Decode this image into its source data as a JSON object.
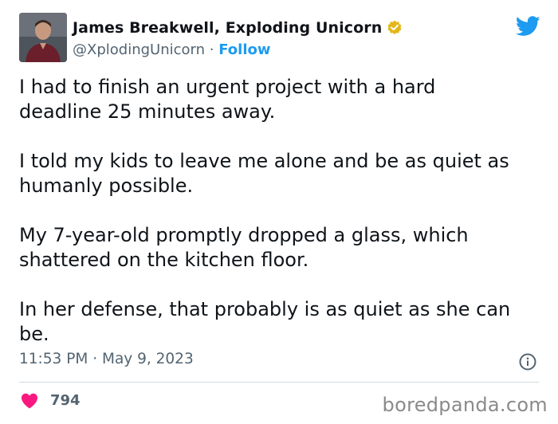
{
  "author": {
    "name": "James Breakwell, Exploding Unicorn",
    "handle": "@XplodingUnicorn",
    "separator": "·",
    "follow_label": "Follow"
  },
  "tweet": {
    "paragraphs": [
      "I had to finish an urgent project with a hard\ndeadline 25 minutes away.",
      "I told my kids to leave me alone and be as quiet as\nhumanly possible.",
      "My 7-year-old promptly dropped a glass, which\nshattered on the kitchen floor.",
      "In her defense, that probably is as quiet as she can\nbe."
    ],
    "time": "11:53 PM",
    "date": "May 9, 2023",
    "meta_separator": "·"
  },
  "engagement": {
    "likes": "794"
  },
  "watermark": "boredpanda.com",
  "colors": {
    "accent": "#1d9bf0",
    "verified": "#e2b719",
    "heart": "#f91880",
    "muted": "#536471"
  },
  "icons": [
    "verified-badge-icon",
    "twitter-bird-icon",
    "info-icon",
    "heart-icon"
  ]
}
